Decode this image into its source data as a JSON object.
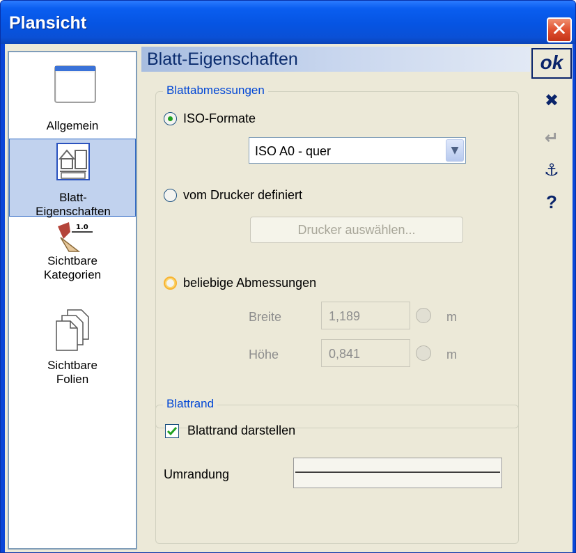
{
  "window": {
    "title": "Plansicht",
    "close_glyph": "✕"
  },
  "nav": {
    "items": [
      {
        "label_lines": [
          "Allgemein"
        ],
        "icon": "window-icon"
      },
      {
        "label_lines": [
          "Blatt-",
          "Eigenschaften"
        ],
        "icon": "sheet-icon",
        "selected": true
      },
      {
        "label_lines": [
          "Sichtbare",
          "Kategorien"
        ],
        "icon": "categories-icon"
      },
      {
        "label_lines": [
          "Sichtbare",
          "Folien"
        ],
        "icon": "layers-icon"
      }
    ]
  },
  "toolbar": {
    "ok_label": "ok",
    "cancel_glyph": "✖",
    "apply_glyph": "↵",
    "anchor_glyph": "⚓",
    "help_glyph": "?"
  },
  "panel": {
    "heading": "Blatt-Eigenschaften",
    "dimensions": {
      "legend": "Blattabmessungen",
      "iso_label": "ISO-Formate",
      "iso_selected": "ISO A0 - quer",
      "printer_label": "vom Drucker definiert",
      "printer_button": "Drucker auswählen...",
      "custom_label": "beliebige Abmessungen",
      "width_label": "Breite",
      "width_value": "1,189",
      "height_label": "Höhe",
      "height_value": "0,841",
      "unit": "m"
    },
    "border": {
      "legend": "Blattrand",
      "show_label": "Blattrand darstellen",
      "show_checked": true,
      "outline_label": "Umrandung"
    }
  },
  "colors": {
    "title_bar": "#0a5ef0",
    "accent": "#0046d5",
    "radio_dot": "#21a121",
    "check_mark": "#21a121"
  }
}
